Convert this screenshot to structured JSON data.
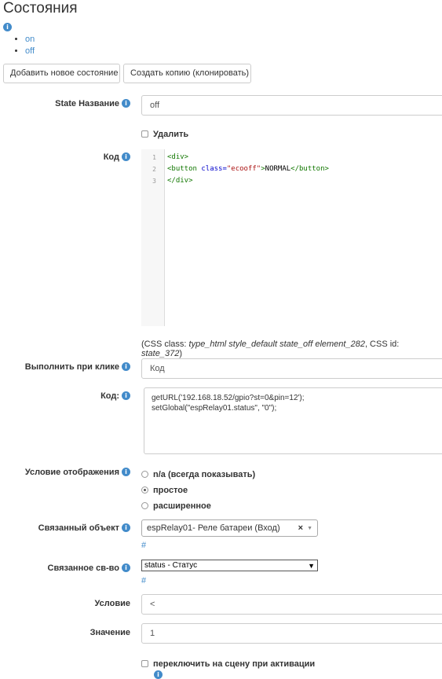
{
  "page": {
    "title": "Состояния",
    "info_icon": "info-icon"
  },
  "states": [
    {
      "label": "on"
    },
    {
      "label": "off"
    }
  ],
  "toolbar": {
    "add_label": "Добавить новое состояние",
    "clone_label": "Создать копию (клонировать)"
  },
  "form": {
    "state_name": {
      "label": "State Название",
      "value": "off"
    },
    "delete": {
      "label": "Удалить",
      "checked": false
    },
    "code": {
      "label": "Код",
      "line_numbers": [
        "1",
        "2",
        "3"
      ],
      "line1": {
        "tag": "<div>"
      },
      "line2": {
        "open": "<button ",
        "attr": "class=",
        "attrval": "\"ecooff\"",
        "close_open": ">",
        "text": "NORMAL",
        "close": "</button>"
      },
      "line3": {
        "tag": "</div>"
      },
      "css_note": {
        "prefix": "(CSS class: ",
        "classes": "type_html style_default state_off element_282",
        "mid": ", CSS id: ",
        "id": "state_372",
        "suffix": ")"
      }
    },
    "on_click": {
      "label": "Выполнить при клике",
      "value": "Код"
    },
    "click_code": {
      "label": "Код:",
      "line1": "getURL('192.168.18.52/gpio?st=0&pin=12');",
      "line2": "setGlobal(\"espRelay01.status\", \"0\");"
    },
    "display_condition": {
      "label": "Условие отображения",
      "options": [
        {
          "label": "n/a (всегда показывать)",
          "selected": false
        },
        {
          "label": "простое",
          "selected": true
        },
        {
          "label": "расширенное",
          "selected": false
        }
      ]
    },
    "linked_object": {
      "label": "Связанный объект",
      "value": "espRelay01- Реле батареи (Вход)",
      "clear": "×",
      "link": "#"
    },
    "linked_property": {
      "label": "Связанное св-во",
      "value": "status - Статус",
      "link": "#"
    },
    "condition": {
      "label": "Условие",
      "value": "<"
    },
    "value": {
      "label": "Значение",
      "value": "1"
    },
    "switch_scene": {
      "label": "переключить на сцену при активации",
      "checked": false
    }
  }
}
